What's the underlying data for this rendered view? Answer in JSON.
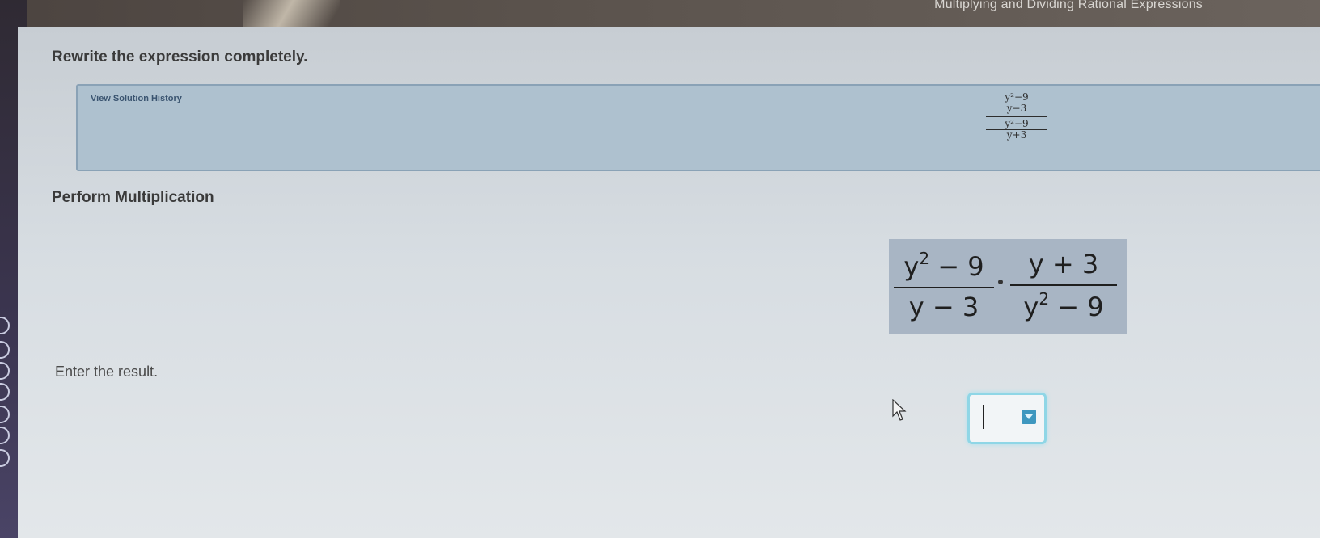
{
  "window": {
    "title": "Multiplying and Dividing Rational Expressions"
  },
  "main": {
    "instruction": "Rewrite the expression completely.",
    "history_link": "View Solution History",
    "complex_fraction": {
      "top_numerator": "y²−9",
      "top_denominator": "y−3",
      "bottom_numerator": "y²−9",
      "bottom_denominator": "y+3"
    },
    "step_label": "Perform Multiplication",
    "expression": {
      "left_numerator_base": "y",
      "left_numerator_exp": "2",
      "left_numerator_rest": " − 9",
      "left_denominator": "y − 3",
      "right_numerator": "y + 3",
      "right_denominator_base": "y",
      "right_denominator_exp": "2",
      "right_denominator_rest": " − 9"
    },
    "enter_label": "Enter the result.",
    "answer": {
      "value": ""
    }
  },
  "icons": {
    "dropdown": "chevron-down-icon",
    "cursor": "mouse-pointer-icon"
  },
  "colors": {
    "history_box": "#aec1cf",
    "expression_box": "#a8b5c4",
    "answer_border": "#8fd6e6",
    "dropdown_accent": "#3e97bf"
  }
}
